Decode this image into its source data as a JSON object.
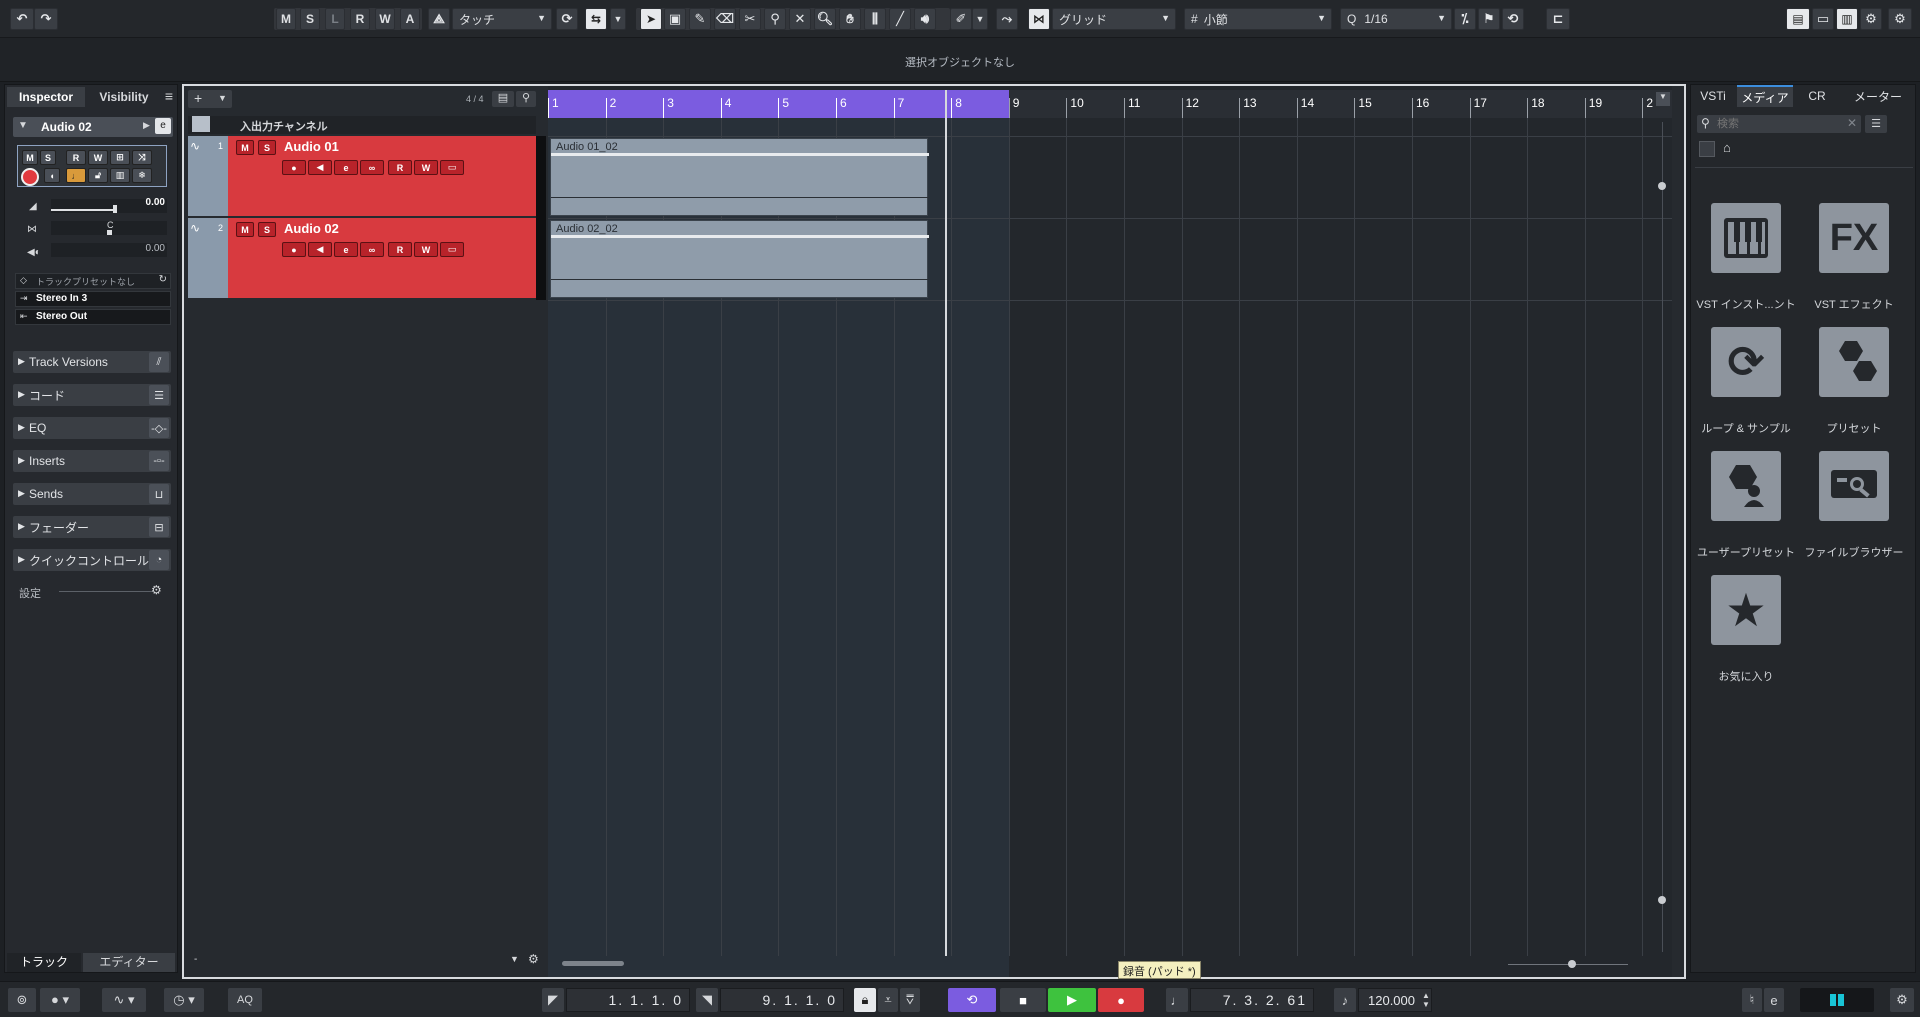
{
  "toolbar": {
    "undo_icon": "undo-icon",
    "redo_icon": "redo-icon",
    "state_buttons": [
      "M",
      "S",
      "L",
      "R",
      "W",
      "A"
    ],
    "automation_mode": "タッチ",
    "snap_type": "グリッド",
    "grid_type": "小節",
    "quantize": "1/16"
  },
  "info_line": {
    "text": "選択オブジェクトなし"
  },
  "inspector": {
    "tabs": [
      "Inspector",
      "Visibility"
    ],
    "track_name": "Audio 02",
    "volume_value": "0.00",
    "pan_value": "C",
    "delay_value": "0.00",
    "preset_label": "トラックプリセットなし",
    "input_routing": "Stereo In 3",
    "output_routing": "Stereo Out",
    "sections": [
      "Track Versions",
      "コード",
      "EQ",
      "Inserts",
      "Sends",
      "フェーダー",
      "クイックコントロール"
    ],
    "settings_label": "設定",
    "bottom_tabs": [
      "トラック",
      "エディター"
    ]
  },
  "project": {
    "track_count": "4 / 4",
    "io_channel": "入出力チャンネル",
    "tracks": [
      {
        "number": "1",
        "name": "Audio 01",
        "clip": "Audio 01_02"
      },
      {
        "number": "2",
        "name": "Audio 02",
        "clip": "Audio 02_02"
      }
    ],
    "ruler": [
      "1",
      "2",
      "3",
      "4",
      "5",
      "6",
      "7",
      "8",
      "9",
      "10",
      "11",
      "12",
      "13",
      "14",
      "15",
      "16",
      "17",
      "18",
      "19",
      "2"
    ]
  },
  "right_zone": {
    "tabs": [
      "VSTi",
      "メディア",
      "CR",
      "メーター"
    ],
    "search_placeholder": "検索",
    "media": [
      {
        "label": "VST インスト...ント",
        "icon": "piano-icon"
      },
      {
        "label": "VST エフェクト",
        "icon": "fx-icon"
      },
      {
        "label": "ループ & サンプル",
        "icon": "loop-icon"
      },
      {
        "label": "プリセット",
        "icon": "preset-icon"
      },
      {
        "label": "ユーザープリセット",
        "icon": "user-preset-icon"
      },
      {
        "label": "ファイルブラウザー",
        "icon": "file-browser-icon"
      },
      {
        "label": "お気に入り",
        "icon": "star-icon"
      }
    ]
  },
  "transport": {
    "aq_label": "AQ",
    "left_locator": "1. 1. 1.  0",
    "right_locator": "9. 1. 1.  0",
    "position": "7. 3. 2. 61",
    "tempo": "120.000",
    "tooltip": "録音 (パッド *)"
  },
  "colors": {
    "track_red": "#d83a3f",
    "cycle_purple": "#7b5ce0",
    "play_green": "#3ec23e",
    "record_red": "#d83a3f"
  }
}
